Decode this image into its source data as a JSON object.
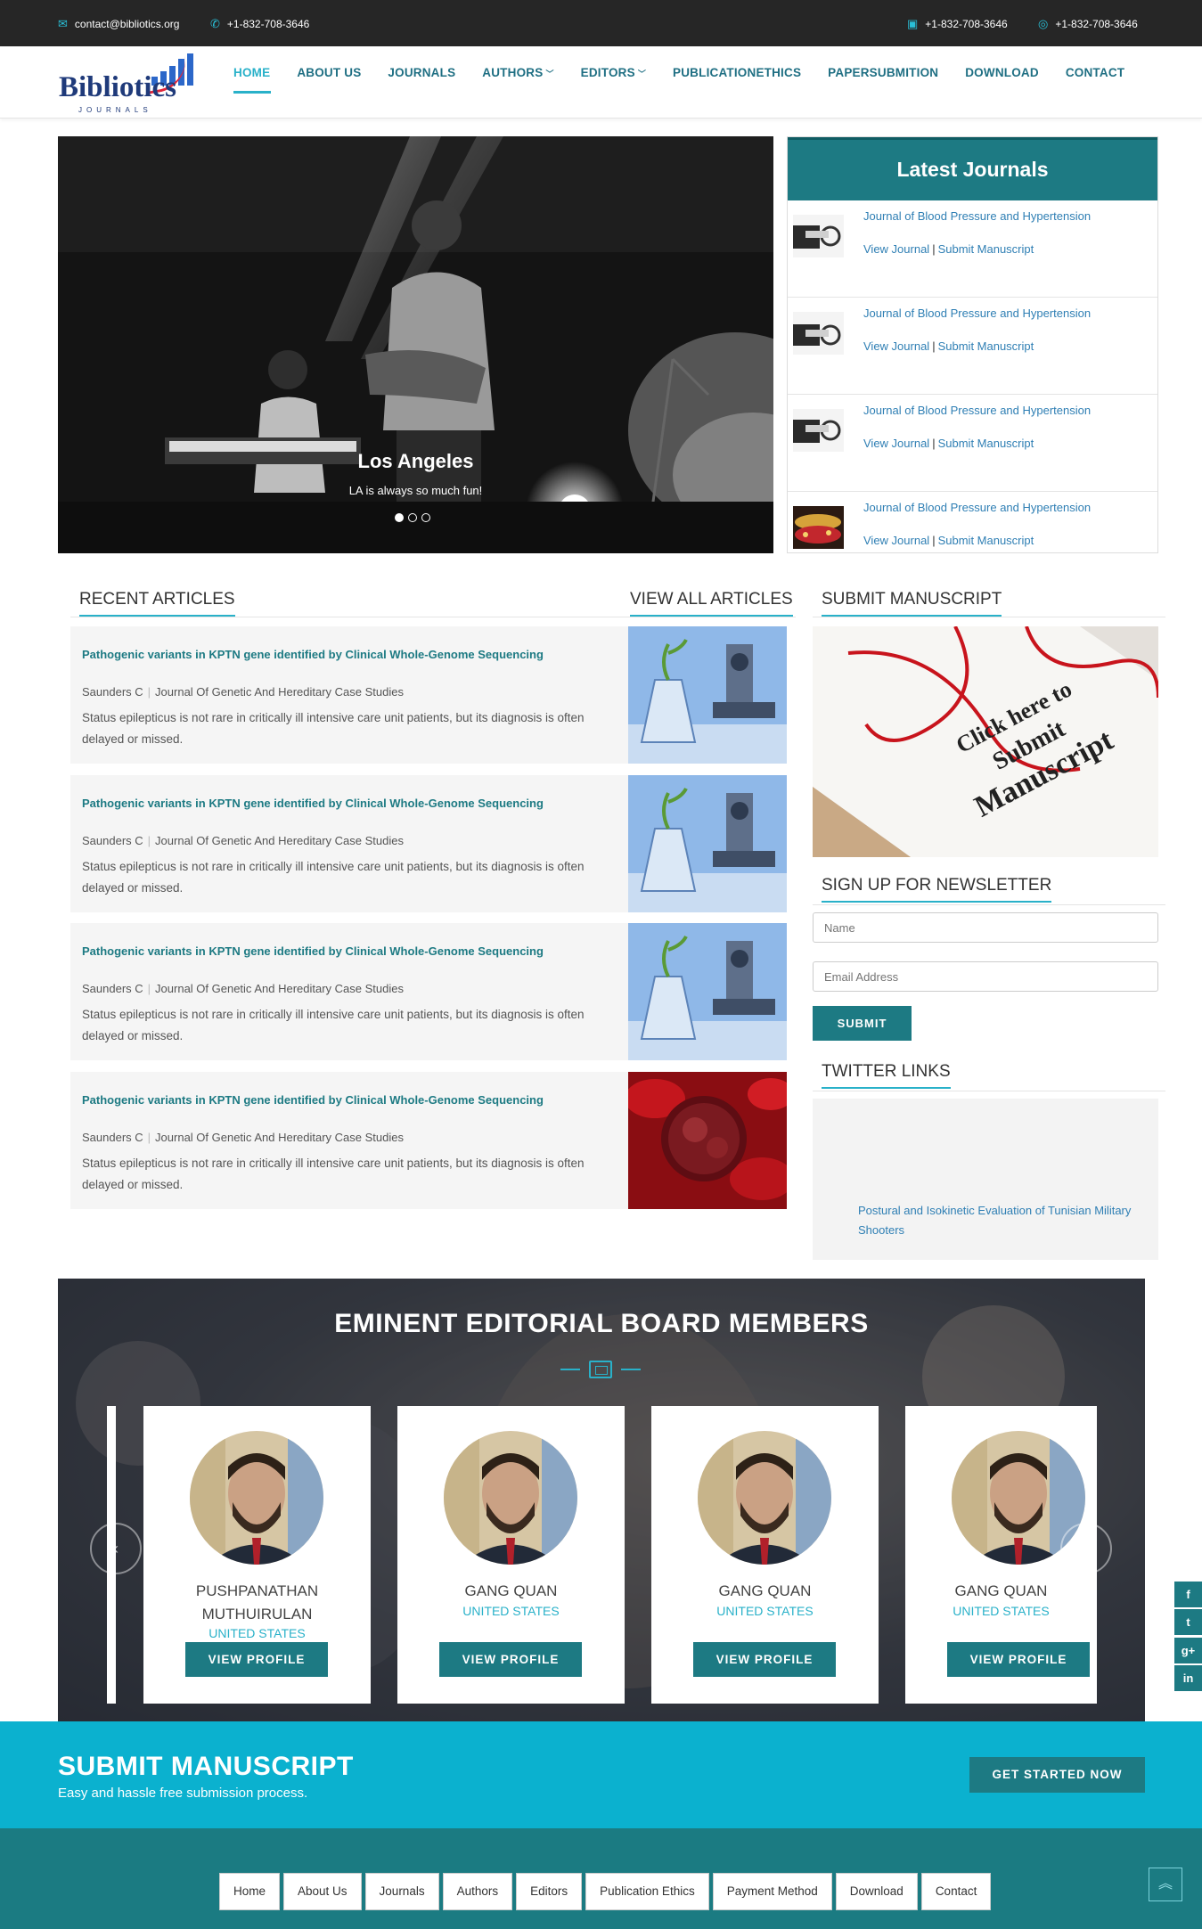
{
  "topbar": {
    "email": "contact@bibliotics.org",
    "phone_left": "+1-832-708-3646",
    "phone_right1": "+1-832-708-3646",
    "phone_right2": "+1-832-708-3646"
  },
  "logo": {
    "name": "Bibliotics",
    "sub": "JOURNALS"
  },
  "nav": {
    "home": "HOME",
    "about": "ABOUT US",
    "journals": "JOURNALS",
    "authors": "AUTHORS",
    "editors": "EDITORS",
    "ethics": "PUBLICATIONETHICS",
    "paper": "PAPERSUBMITION",
    "download": "DOWNLOAD",
    "contact": "CONTACT"
  },
  "hero": {
    "caption_title": "Los Angeles",
    "caption_text": "LA is always so much fun!",
    "slide_count": 3,
    "active_slide": 1
  },
  "latest": {
    "title": "Latest Journals",
    "items": [
      {
        "title": "Journal of Blood Pressure and Hypertension",
        "view": "View Journal",
        "sep": "|",
        "submit": "Submit Manuscript"
      },
      {
        "title": "Journal of Blood Pressure and Hypertension",
        "view": "View Journal",
        "sep": "|",
        "submit": "Submit Manuscript"
      },
      {
        "title": "Journal of Blood Pressure and Hypertension",
        "view": "View Journal",
        "sep": "|",
        "submit": "Submit Manuscript"
      },
      {
        "title": "Journal of Blood Pressure and Hypertension",
        "view": "View Journal",
        "sep": "|",
        "submit": "Submit Manuscript"
      }
    ]
  },
  "articles": {
    "heading": "RECENT ARTICLES",
    "view_all": "VIEW ALL ARTICLES",
    "items": [
      {
        "title": "Pathogenic variants in KPTN gene identified by Clinical Whole-Genome Sequencing",
        "author": "Saunders C",
        "sep": "|",
        "journal": "Journal Of Genetic And Hereditary Case Studies",
        "desc": "Status epilepticus is not rare in critically ill intensive care unit patients, but its diagnosis is often delayed or missed."
      },
      {
        "title": "Pathogenic variants in KPTN gene identified by Clinical Whole-Genome Sequencing",
        "author": "Saunders C",
        "sep": "|",
        "journal": "Journal Of Genetic And Hereditary Case Studies",
        "desc": "Status epilepticus is not rare in critically ill intensive care unit patients, but its diagnosis is often delayed or missed."
      },
      {
        "title": "Pathogenic variants in KPTN gene identified by Clinical Whole-Genome Sequencing",
        "author": "Saunders C",
        "sep": "|",
        "journal": "Journal Of Genetic And Hereditary Case Studies",
        "desc": "Status epilepticus is not rare in critically ill intensive care unit patients, but its diagnosis is often delayed or missed."
      },
      {
        "title": "Pathogenic variants in KPTN gene identified by Clinical Whole-Genome Sequencing",
        "author": "Saunders C",
        "sep": "|",
        "journal": "Journal Of Genetic And Hereditary Case Studies",
        "desc": "Status epilepticus is not rare in critically ill intensive care unit patients, but its diagnosis is often delayed or missed."
      }
    ]
  },
  "sidebar": {
    "submit_heading": "SUBMIT MANUSCRIPT",
    "submit_img_line1": "Click here to",
    "submit_img_line2": "Submit",
    "submit_img_line3": "Manuscript",
    "newsletter_heading": "SIGN UP FOR NEWSLETTER",
    "name_placeholder": "Name",
    "email_placeholder": "Email Address",
    "submit_button": "SUBMIT",
    "twitter_heading": "TWITTER LINKS",
    "twitter_link": "Postural and Isokinetic Evaluation of Tunisian Military Shooters"
  },
  "board": {
    "title": "EMINENT EDITORIAL BOARD MEMBERS",
    "prev_icon": "‹",
    "next_icon": "›",
    "members": [
      {
        "name": "PUSHPANATHAN MUTHUIRULAN",
        "country": "UNITED STATES",
        "button": "VIEW PROFILE"
      },
      {
        "name": "GANG QUAN",
        "country": "UNITED STATES",
        "button": "VIEW PROFILE"
      },
      {
        "name": "GANG QUAN",
        "country": "UNITED STATES",
        "button": "VIEW PROFILE"
      },
      {
        "name": "GANG QUAN",
        "country": "UNITED STATES",
        "button": "VIEW PROFILE"
      }
    ]
  },
  "social": {
    "facebook": "f",
    "twitter": "t",
    "googleplus": "g+",
    "linkedin": "in"
  },
  "cta": {
    "title": "SUBMIT MANUSCRIPT",
    "subtitle": "Easy and hassle free submission process.",
    "button": "GET STARTED NOW"
  },
  "footer": {
    "links": [
      "Home",
      "About Us",
      "Journals",
      "Authors",
      "Editors",
      "Publication Ethics",
      "Payment Method",
      "Download",
      "Contact"
    ],
    "top_icon": "︽"
  },
  "colors": {
    "teal": "#1d7a83",
    "cyan": "#29b1c9",
    "cta": "#0bb1cf",
    "topbar": "#262626",
    "link": "#2f7fb4"
  }
}
